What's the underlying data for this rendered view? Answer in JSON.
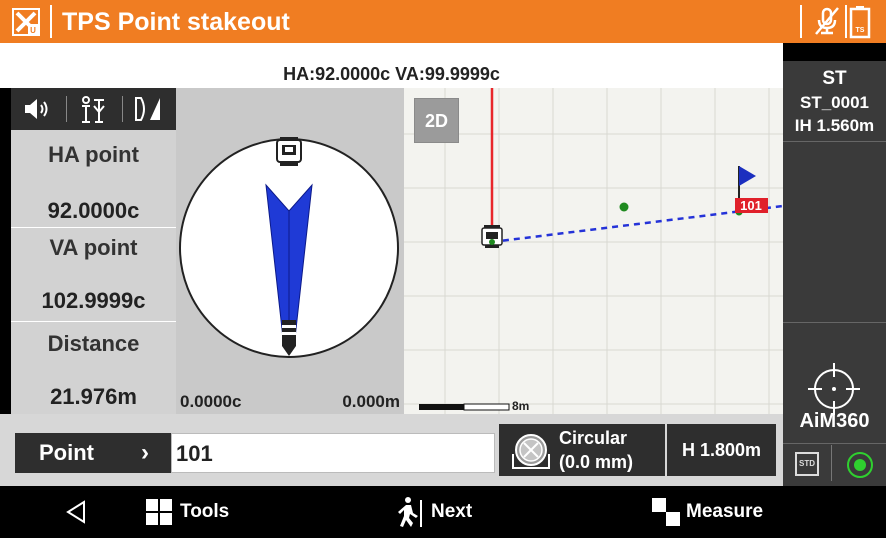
{
  "titlebar": {
    "title": "TPS Point stakeout",
    "accent": "#f07d22"
  },
  "angles": {
    "text": "HA:92.0000c  VA:99.9999c"
  },
  "left_panel": {
    "icons": [
      "sound-icon",
      "person-icon",
      "face-orientation-icon"
    ],
    "ha_label": "HA point",
    "ha_value": "92.0000c",
    "va_label": "VA point",
    "va_value": "102.9999c",
    "dist_label": "Distance",
    "dist_value": "21.976m"
  },
  "compass": {
    "ha_diff": "0.0000c",
    "dist_diff": "0.000m"
  },
  "map": {
    "mode_button": "2D",
    "point_label": "101",
    "scale_label": "8m"
  },
  "right_panel": {
    "st_label": "ST",
    "st_name": "ST_0001",
    "ih": "IH 1.560m",
    "prism_name": "AiM360",
    "std_label": "STD"
  },
  "form": {
    "point_button": "Point",
    "point_chevron": "›",
    "point_value": "101",
    "prism_line1": "Circular",
    "prism_line2": "(0.0 mm)",
    "height": "H 1.800m"
  },
  "nav": {
    "tools": "Tools",
    "next": "Next",
    "measure": "Measure"
  }
}
